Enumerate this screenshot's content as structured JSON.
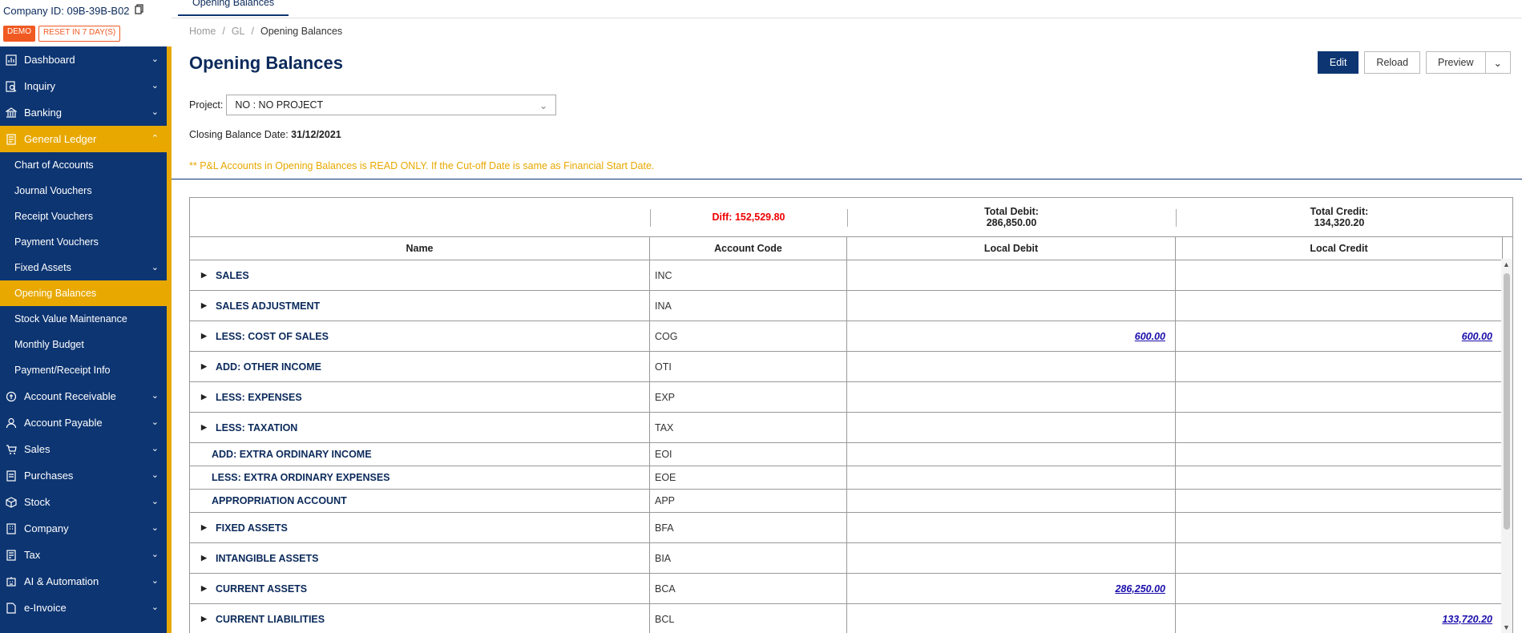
{
  "company": {
    "label": "Company ID: 09B-39B-B02"
  },
  "badges": {
    "demo": "DEMO",
    "reset": "RESET IN 7 DAY(S)"
  },
  "nav": {
    "dashboard": "Dashboard",
    "inquiry": "Inquiry",
    "banking": "Banking",
    "general_ledger": "General Ledger",
    "gl_items": [
      "Chart of Accounts",
      "Journal Vouchers",
      "Receipt Vouchers",
      "Payment Vouchers",
      "Fixed Assets",
      "Opening Balances",
      "Stock Value Maintenance",
      "Monthly Budget",
      "Payment/Receipt Info"
    ],
    "account_receivable": "Account Receivable",
    "account_payable": "Account Payable",
    "sales": "Sales",
    "purchases": "Purchases",
    "stock": "Stock",
    "company": "Company",
    "tax": "Tax",
    "ai": "AI & Automation",
    "einvoice": "e-Invoice"
  },
  "tab": {
    "label": "Opening Balances"
  },
  "breadcrumb": {
    "home": "Home",
    "gl": "GL",
    "current": "Opening Balances"
  },
  "page": {
    "title": "Opening Balances"
  },
  "toolbar": {
    "edit": "Edit",
    "reload": "Reload",
    "preview": "Preview"
  },
  "project": {
    "label": "Project:",
    "value": "NO : NO PROJECT"
  },
  "closing": {
    "label": "Closing Balance Date:",
    "value": "31/12/2021"
  },
  "warning": "** P&L Accounts in Opening Balances is READ ONLY. If the Cut-off Date is same as Financial Start Date.",
  "summary": {
    "diff": "Diff: 152,529.80",
    "total_debit_label": "Total Debit:",
    "total_debit": "286,850.00",
    "total_credit_label": "Total Credit:",
    "total_credit": "134,320.20"
  },
  "columns": {
    "name": "Name",
    "code": "Account Code",
    "debit": "Local Debit",
    "credit": "Local Credit"
  },
  "rows": [
    {
      "name": "SALES",
      "code": "INC",
      "debit": "",
      "credit": ""
    },
    {
      "name": "SALES ADJUSTMENT",
      "code": "INA",
      "debit": "",
      "credit": ""
    },
    {
      "name": "LESS: COST OF SALES",
      "code": "COG",
      "debit": "600.00",
      "credit": "600.00"
    },
    {
      "name": "ADD: OTHER INCOME",
      "code": "OTI",
      "debit": "",
      "credit": ""
    },
    {
      "name": "LESS: EXPENSES",
      "code": "EXP",
      "debit": "",
      "credit": ""
    },
    {
      "name": "LESS: TAXATION",
      "code": "TAX",
      "debit": "",
      "credit": ""
    },
    {
      "name": "ADD: EXTRA ORDINARY INCOME",
      "code": "EOI",
      "debit": "",
      "credit": ""
    },
    {
      "name": "LESS: EXTRA ORDINARY EXPENSES",
      "code": "EOE",
      "debit": "",
      "credit": ""
    },
    {
      "name": "APPROPRIATION ACCOUNT",
      "code": "APP",
      "debit": "",
      "credit": ""
    },
    {
      "name": "FIXED ASSETS",
      "code": "BFA",
      "debit": "",
      "credit": ""
    },
    {
      "name": "INTANGIBLE ASSETS",
      "code": "BIA",
      "debit": "",
      "credit": ""
    },
    {
      "name": "CURRENT ASSETS",
      "code": "BCA",
      "debit": "286,250.00",
      "credit": ""
    },
    {
      "name": "CURRENT LIABILITIES",
      "code": "BCL",
      "debit": "",
      "credit": "133,720.20"
    }
  ]
}
